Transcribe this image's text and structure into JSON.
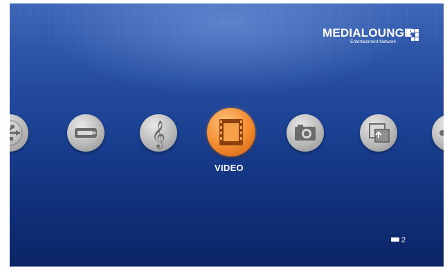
{
  "brand": {
    "name": "MEDIALOUNGE",
    "tagline": "Entertainment Network"
  },
  "menu": {
    "selected_label": "VIDEO",
    "items": [
      {
        "id": "usb",
        "icon": "usb-icon"
      },
      {
        "id": "hdd",
        "icon": "hard-drive-icon"
      },
      {
        "id": "music",
        "icon": "treble-clef-icon"
      },
      {
        "id": "video",
        "icon": "film-frame-icon",
        "label": "VIDEO",
        "selected": true
      },
      {
        "id": "photo",
        "icon": "camera-icon"
      },
      {
        "id": "upload",
        "icon": "upload-icon"
      },
      {
        "id": "next",
        "icon": "partial-icon"
      }
    ]
  },
  "status": {
    "page_indicator": "2",
    "page_indicator_icon": "keyboard-icon"
  },
  "colors": {
    "background_top": "#3f67b8",
    "background_bottom": "#0b2566",
    "accent": "#f28a2e",
    "icon_gray": "#b9b9b9",
    "text": "#ffffff"
  }
}
